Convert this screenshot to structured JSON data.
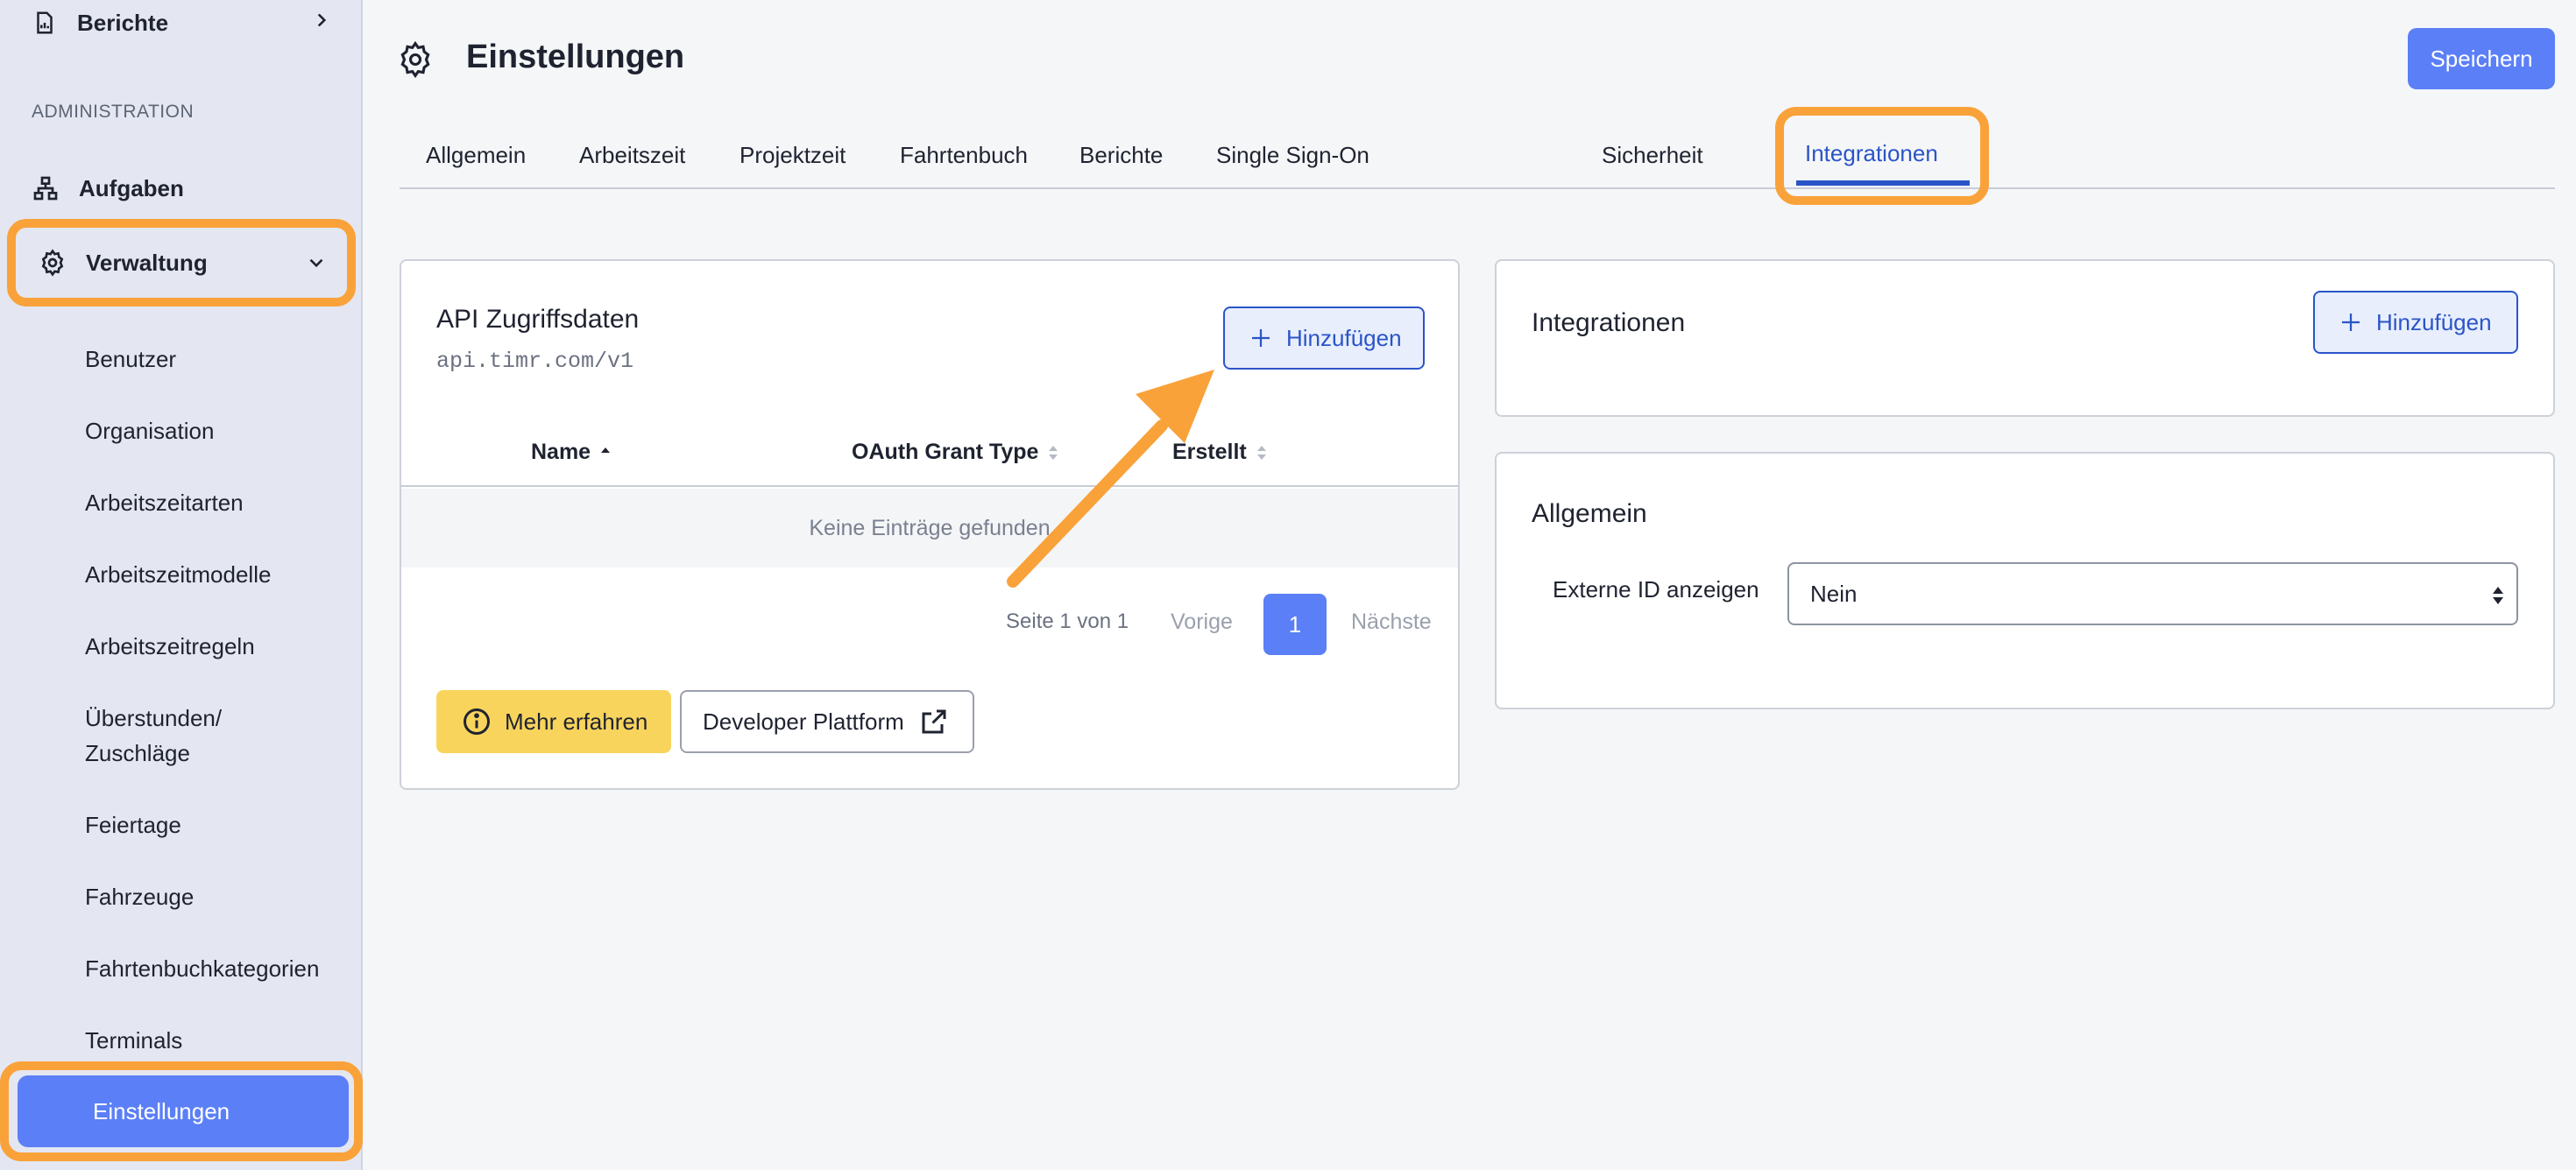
{
  "sidebar": {
    "top_item": "Berichte",
    "section_label": "ADMINISTRATION",
    "aufgaben": "Aufgaben",
    "verwaltung": "Verwaltung",
    "sub_items": [
      "Benutzer",
      "Organisation",
      "Arbeitszeitarten",
      "Arbeitszeitmodelle",
      "Arbeitszeitregeln",
      "Überstunden/",
      "Zuschläge",
      "Feiertage",
      "Fahrzeuge",
      "Fahrtenbuchkategorien",
      "Terminals"
    ],
    "active_item": "Einstellungen"
  },
  "header": {
    "title": "Einstellungen",
    "save_label": "Speichern"
  },
  "tabs": [
    "Allgemein",
    "Arbeitszeit",
    "Projektzeit",
    "Fahrtenbuch",
    "Berichte",
    "Single Sign-On",
    "Integrationen",
    "Sicherheit"
  ],
  "api_card": {
    "title": "API Zugriffsdaten",
    "url": "api.timr.com/v1",
    "add_label": "Hinzufügen",
    "columns": [
      "Name",
      "OAuth Grant Type",
      "Erstellt"
    ],
    "empty_text": "Keine Einträge gefunden",
    "pager_info": "Seite 1 von 1",
    "pager_prev": "Vorige",
    "pager_page": "1",
    "pager_next": "Nächste",
    "more_label": "Mehr erfahren",
    "dev_label": "Developer Plattform"
  },
  "integrations_card": {
    "title": "Integrationen",
    "add_label": "Hinzufügen"
  },
  "general_card": {
    "title": "Allgemein",
    "field_label": "Externe ID anzeigen",
    "field_value": "Nein"
  },
  "colors": {
    "accent": "#5b7ff7",
    "tab_active": "#2a55c7",
    "highlight": "#f9a23a",
    "warning_button": "#f9d45c"
  }
}
